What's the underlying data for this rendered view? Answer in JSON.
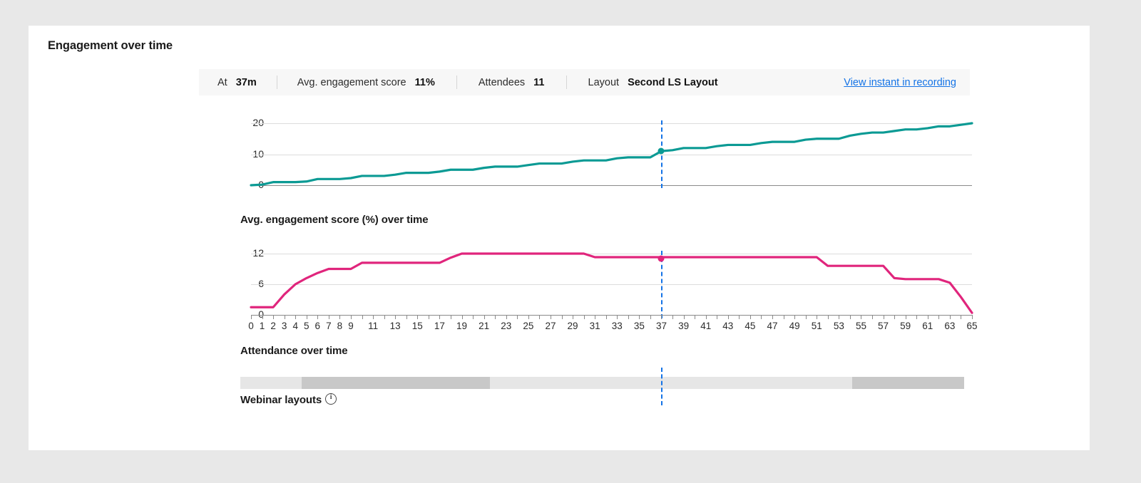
{
  "page_title": "Engagement over time",
  "stats": [
    {
      "label": "At",
      "value": "37m"
    },
    {
      "label": "Avg. engagement score",
      "value": "11%"
    },
    {
      "label": "Attendees",
      "value": "11"
    },
    {
      "label": "Layout",
      "value": "Second LS Layout"
    }
  ],
  "view_link": "View instant in recording",
  "sections": {
    "engagement_title": "Avg. engagement score (%) over time",
    "attendance_title": "Attendance over time",
    "layouts_title": "Webinar layouts",
    "layouts_info_icon": "info-icon"
  },
  "colors": {
    "attendance_line": "#0b9a94",
    "engagement_line": "#e0257c",
    "crosshair": "#1473e6",
    "link": "#1473e6",
    "grid": "#dcdcdc",
    "axis": "#8a8a8a",
    "card_bg": "#ffffff",
    "page_bg": "#e8e8e8",
    "stats_bg": "#f7f7f7"
  },
  "crosshair": {
    "x_value": 37,
    "attendance_at_cursor": 11,
    "engagement_at_cursor": 11
  },
  "chart_data": [
    {
      "type": "line",
      "title": "Attendance over time",
      "xlabel": "",
      "ylabel": "",
      "xlim": [
        0,
        65
      ],
      "ylim": [
        0,
        21
      ],
      "yticks": [
        0,
        10,
        20
      ],
      "ytick_labels": [
        "0",
        "10",
        "20"
      ],
      "grid": true,
      "legend": "none",
      "series": [
        {
          "name": "Attendance",
          "color": "#0b9a94",
          "x": [
            0,
            1,
            2,
            3,
            4,
            5,
            6,
            7,
            8,
            9,
            10,
            11,
            12,
            13,
            14,
            15,
            16,
            17,
            18,
            19,
            20,
            21,
            22,
            23,
            24,
            25,
            26,
            27,
            28,
            29,
            30,
            31,
            32,
            33,
            34,
            35,
            36,
            37,
            38,
            39,
            40,
            41,
            42,
            43,
            44,
            45,
            46,
            47,
            48,
            49,
            50,
            51,
            52,
            53,
            54,
            55,
            56,
            57,
            58,
            59,
            60,
            61,
            62,
            63,
            64,
            65
          ],
          "values": [
            0,
            0.2,
            1,
            1,
            1,
            1.2,
            2,
            2,
            2,
            2.3,
            3,
            3,
            3,
            3.4,
            4,
            4,
            4,
            4.4,
            5,
            5,
            5,
            5.6,
            6,
            6,
            6,
            6.5,
            7,
            7,
            7,
            7.6,
            8,
            8,
            8,
            8.7,
            9,
            9,
            9,
            11,
            11.3,
            12,
            12,
            12,
            12.6,
            13,
            13,
            13,
            13.6,
            14,
            14,
            14,
            14.7,
            15,
            15,
            15,
            16,
            16.6,
            17,
            17,
            17.5,
            18,
            18,
            18.4,
            19,
            19,
            19.5,
            20
          ]
        }
      ]
    },
    {
      "type": "line",
      "title": "Avg. engagement score (%) over time",
      "xlabel": "",
      "ylabel": "",
      "xlim": [
        0,
        65
      ],
      "ylim": [
        0,
        13.5
      ],
      "yticks": [
        0,
        6,
        12
      ],
      "ytick_labels": [
        "0",
        "6",
        "12"
      ],
      "grid": true,
      "legend": "none",
      "series": [
        {
          "name": "Avg. engagement score (%)",
          "color": "#e0257c",
          "x": [
            0,
            1,
            2,
            3,
            4,
            5,
            6,
            7,
            8,
            9,
            10,
            11,
            12,
            13,
            14,
            15,
            16,
            17,
            18,
            19,
            20,
            21,
            22,
            23,
            24,
            25,
            26,
            27,
            28,
            29,
            30,
            31,
            32,
            33,
            34,
            35,
            36,
            37,
            38,
            39,
            40,
            41,
            42,
            43,
            44,
            45,
            46,
            47,
            48,
            49,
            50,
            51,
            52,
            53,
            54,
            55,
            56,
            57,
            58,
            59,
            60,
            61,
            62,
            63,
            64,
            65
          ],
          "values": [
            1.5,
            1.5,
            1.5,
            4,
            6,
            7.2,
            8.2,
            9,
            9,
            9,
            10.2,
            10.2,
            10.2,
            10.2,
            10.2,
            10.2,
            10.2,
            10.2,
            11.2,
            12,
            12,
            12,
            12,
            12,
            12,
            12,
            12,
            12,
            12,
            12,
            12,
            11.3,
            11.3,
            11.3,
            11.3,
            11.3,
            11.3,
            11.3,
            11.3,
            11.3,
            11.3,
            11.3,
            11.3,
            11.3,
            11.3,
            11.3,
            11.3,
            11.3,
            11.3,
            11.3,
            11.3,
            11.3,
            9.6,
            9.6,
            9.6,
            9.6,
            9.6,
            9.6,
            7.2,
            7,
            7,
            7,
            7,
            6.3,
            3.5,
            0.4
          ]
        }
      ]
    }
  ],
  "xaxis_ticks": [
    {
      "value": 0,
      "label": "0"
    },
    {
      "value": 1,
      "label": "1"
    },
    {
      "value": 2,
      "label": "2"
    },
    {
      "value": 3,
      "label": "3"
    },
    {
      "value": 4,
      "label": "4"
    },
    {
      "value": 5,
      "label": "5"
    },
    {
      "value": 6,
      "label": "6"
    },
    {
      "value": 7,
      "label": "7"
    },
    {
      "value": 8,
      "label": "8"
    },
    {
      "value": 9,
      "label": "9"
    },
    {
      "value": 10,
      "label": ""
    },
    {
      "value": 11,
      "label": "11"
    },
    {
      "value": 12,
      "label": ""
    },
    {
      "value": 13,
      "label": "13"
    },
    {
      "value": 14,
      "label": ""
    },
    {
      "value": 15,
      "label": "15"
    },
    {
      "value": 16,
      "label": ""
    },
    {
      "value": 17,
      "label": "17"
    },
    {
      "value": 18,
      "label": ""
    },
    {
      "value": 19,
      "label": "19"
    },
    {
      "value": 20,
      "label": ""
    },
    {
      "value": 21,
      "label": "21"
    },
    {
      "value": 22,
      "label": ""
    },
    {
      "value": 23,
      "label": "23"
    },
    {
      "value": 24,
      "label": ""
    },
    {
      "value": 25,
      "label": "25"
    },
    {
      "value": 26,
      "label": ""
    },
    {
      "value": 27,
      "label": "27"
    },
    {
      "value": 28,
      "label": ""
    },
    {
      "value": 29,
      "label": "29"
    },
    {
      "value": 30,
      "label": ""
    },
    {
      "value": 31,
      "label": "31"
    },
    {
      "value": 32,
      "label": ""
    },
    {
      "value": 33,
      "label": "33"
    },
    {
      "value": 34,
      "label": ""
    },
    {
      "value": 35,
      "label": "35"
    },
    {
      "value": 36,
      "label": ""
    },
    {
      "value": 37,
      "label": "37"
    },
    {
      "value": 38,
      "label": ""
    },
    {
      "value": 39,
      "label": "39"
    },
    {
      "value": 40,
      "label": ""
    },
    {
      "value": 41,
      "label": "41"
    },
    {
      "value": 42,
      "label": ""
    },
    {
      "value": 43,
      "label": "43"
    },
    {
      "value": 44,
      "label": ""
    },
    {
      "value": 45,
      "label": "45"
    },
    {
      "value": 46,
      "label": ""
    },
    {
      "value": 47,
      "label": "47"
    },
    {
      "value": 48,
      "label": ""
    },
    {
      "value": 49,
      "label": "49"
    },
    {
      "value": 50,
      "label": ""
    },
    {
      "value": 51,
      "label": "51"
    },
    {
      "value": 52,
      "label": ""
    },
    {
      "value": 53,
      "label": "53"
    },
    {
      "value": 54,
      "label": ""
    },
    {
      "value": 55,
      "label": "55"
    },
    {
      "value": 56,
      "label": ""
    },
    {
      "value": 57,
      "label": "57"
    },
    {
      "value": 58,
      "label": ""
    },
    {
      "value": 59,
      "label": "59"
    },
    {
      "value": 60,
      "label": ""
    },
    {
      "value": 61,
      "label": "61"
    },
    {
      "value": 62,
      "label": ""
    },
    {
      "value": 63,
      "label": "63"
    },
    {
      "value": 64,
      "label": ""
    },
    {
      "value": 65,
      "label": "65"
    }
  ],
  "layout_segments": [
    {
      "start_pct": 0.0,
      "end_pct": 8.5,
      "color": "#e6e6e6"
    },
    {
      "start_pct": 8.5,
      "end_pct": 34.5,
      "color": "#c8c8c8"
    },
    {
      "start_pct": 34.5,
      "end_pct": 84.5,
      "color": "#e6e6e6"
    },
    {
      "start_pct": 84.5,
      "end_pct": 100,
      "color": "#c8c8c8"
    }
  ]
}
